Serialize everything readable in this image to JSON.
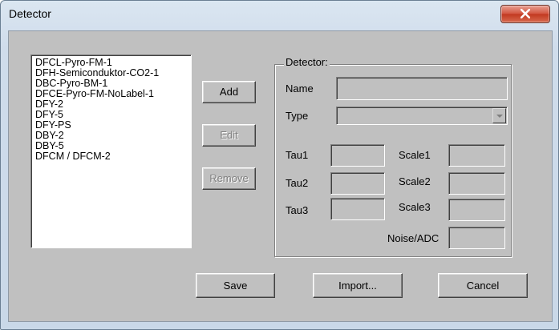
{
  "window": {
    "title": "Detector"
  },
  "detector_list": {
    "items": [
      "DFCL-Pyro-FM-1",
      "DFH-Semiconduktor-CO2-1",
      "DBC-Pyro-BM-1",
      "DFCE-Pyro-FM-NoLabel-1",
      "DFY-2",
      "DFY-5",
      "DFY-PS",
      "DBY-2",
      "DBY-5",
      "DFCM / DFCM-2"
    ]
  },
  "list_buttons": {
    "add": "Add",
    "edit": "Edit",
    "remove": "Remove"
  },
  "detector_group": {
    "legend": "Detector:",
    "name_label": "Name",
    "name_value": "",
    "type_label": "Type",
    "type_value": "",
    "tau1_label": "Tau1",
    "tau2_label": "Tau2",
    "tau3_label": "Tau3",
    "scale1_label": "Scale1",
    "scale2_label": "Scale2",
    "scale3_label": "Scale3",
    "noise_label": "Noise/ADC"
  },
  "footer_buttons": {
    "save": "Save",
    "import": "Import...",
    "cancel": "Cancel"
  },
  "icons": {
    "close": "close-icon",
    "dropdown": "chevron-down-icon"
  }
}
